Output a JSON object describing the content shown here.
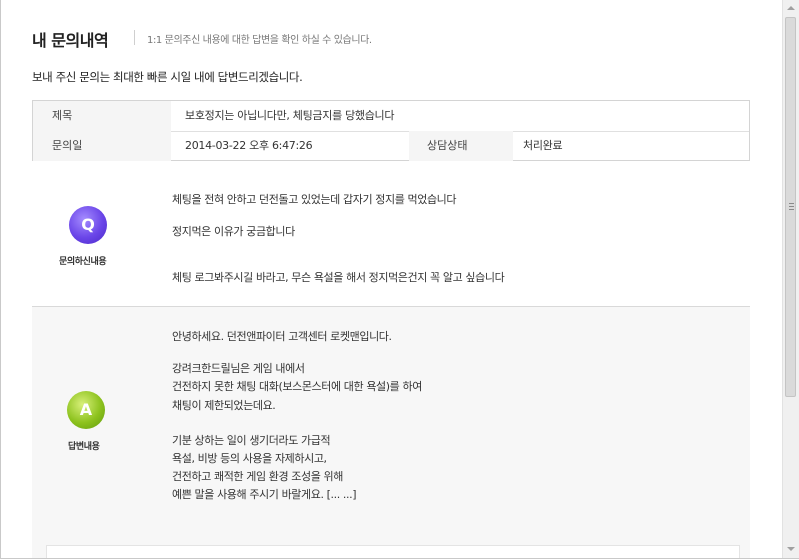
{
  "header": {
    "title": "내 문의내역",
    "description": "1:1 문의주신 내용에 대한 답변을 확인 하실 수 있습니다."
  },
  "intro": "보내 주신 문의는 최대한 빠른 시일 내에 답변드리겠습니다.",
  "info": {
    "subject_label": "제목",
    "subject_value": "보호정지는 아닙니다만, 체팅금지를 당했습니다",
    "date_label": "문의일",
    "date_value": "2014-03-22 오후 6:47:26",
    "status_label": "상담상태",
    "status_value": "처리완료"
  },
  "question": {
    "badge": "Q",
    "caption": "문의하신내용",
    "lines": [
      "체팅을 전혀 안하고 던전돌고 있었는데 갑자기 정지를 먹었습니다",
      "정지먹은 이유가 궁금합니다",
      "체팅 로그봐주시길 바라고, 무슨 욕설을 해서 정지먹은건지 꼭 알고 싶습니다"
    ]
  },
  "answer": {
    "badge": "A",
    "caption": "답변내용",
    "lines": [
      "안녕하세요. 던전앤파이터 고객센터 로켓맨입니다.",
      "강려크한드릴님은 게임 내에서",
      "건전하지 못한 채팅 대화(보스몬스터에 대한 욕설)를 하여",
      "채팅이 제한되었는데요.",
      "기분 상하는 일이 생기더라도 가급적",
      "욕설, 비방 등의 사용을 자제하시고,",
      "건전하고 쾌적한 게임 환경 조성을 위해",
      "예쁜 말을 사용해 주시기 바랄게요. [... ...]"
    ]
  },
  "colors": {
    "q_badge": "#6a45e8",
    "a_badge": "#8dc21e",
    "label_bg": "#f5f5f5",
    "answer_bg": "#f7f7f7"
  }
}
